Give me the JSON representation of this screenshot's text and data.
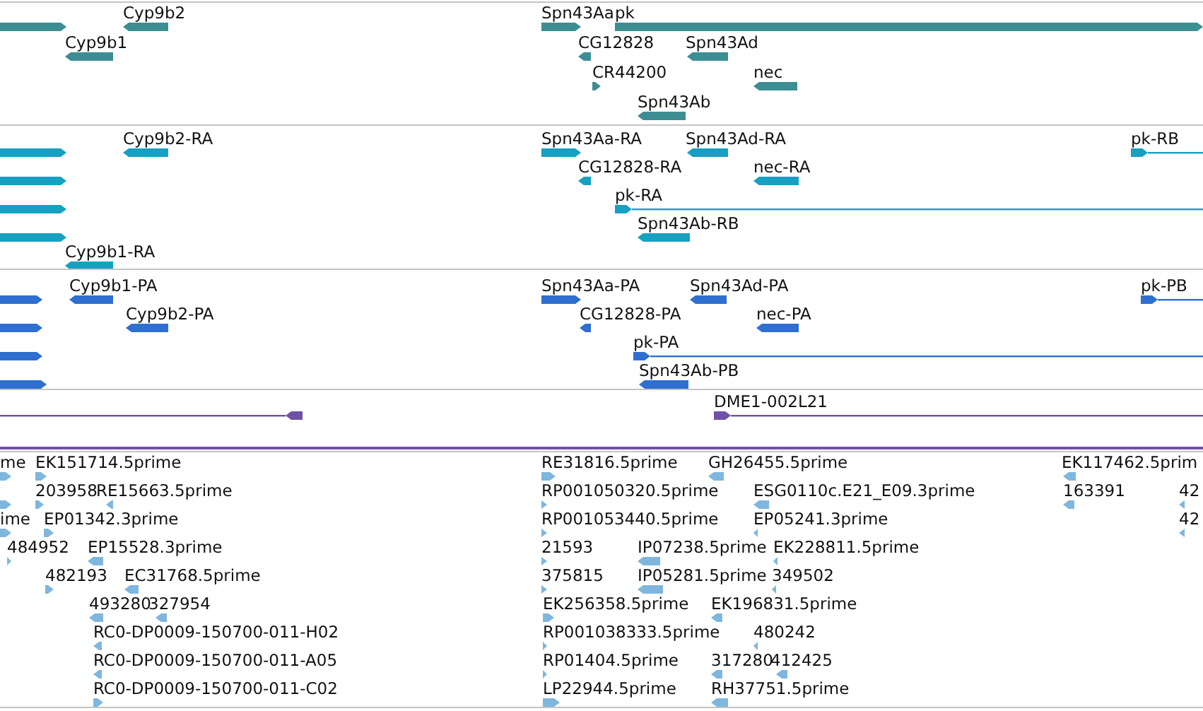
{
  "tracks": [
    {
      "kind": "gene",
      "color": "#3d8e93",
      "features": [
        {
          "kind": "right"
        },
        {
          "label": "Cyp9b2",
          "kind": "left"
        },
        {
          "label": "Cyp9b1",
          "kind": "left"
        },
        {
          "label": "Spn43Aa",
          "kind": "right"
        },
        {
          "label": "pk",
          "kind": "right"
        },
        {
          "label": "CG12828",
          "kind": "left"
        },
        {
          "label": "Spn43Ad",
          "kind": "left"
        },
        {
          "label": "CR44200",
          "kind": "right"
        },
        {
          "label": "nec",
          "kind": "left"
        },
        {
          "label": "Spn43Ab",
          "kind": "left"
        }
      ]
    },
    {
      "kind": "transcript",
      "color": "#17a0c2",
      "features": [
        {
          "kind": "right"
        },
        {
          "kind": "right"
        },
        {
          "kind": "right"
        },
        {
          "kind": "right"
        },
        {
          "label": "Cyp9b2-RA",
          "kind": "left"
        },
        {
          "label": "Cyp9b1-RA",
          "kind": "left"
        },
        {
          "label": "Spn43Aa-RA",
          "kind": "right"
        },
        {
          "label": "Spn43Ad-RA",
          "kind": "left"
        },
        {
          "label": "pk-RB",
          "kind": "rightline"
        },
        {
          "label": "CG12828-RA",
          "kind": "left"
        },
        {
          "label": "nec-RA",
          "kind": "left"
        },
        {
          "label": "pk-RA",
          "kind": "rightline"
        },
        {
          "label": "Spn43Ab-RB",
          "kind": "left"
        }
      ]
    },
    {
      "kind": "protein",
      "color": "#2e6fd0",
      "features": [
        {
          "kind": "right"
        },
        {
          "kind": "right"
        },
        {
          "kind": "right"
        },
        {
          "kind": "right"
        },
        {
          "label": "Cyp9b1-PA",
          "kind": "left"
        },
        {
          "label": "Cyp9b2-PA",
          "kind": "left"
        },
        {
          "label": "Spn43Aa-PA",
          "kind": "right"
        },
        {
          "label": "Spn43Ad-PA",
          "kind": "left"
        },
        {
          "label": "pk-PB",
          "kind": "rightline"
        },
        {
          "label": "CG12828-PA",
          "kind": "left"
        },
        {
          "label": "nec-PA",
          "kind": "left"
        },
        {
          "label": "pk-PA",
          "kind": "rightline"
        },
        {
          "label": "Spn43Ab-PB",
          "kind": "left"
        }
      ]
    },
    {
      "kind": "clone",
      "color": "#6e52a6",
      "features": [
        {
          "kind": "leftline"
        },
        {
          "label": "DME1-002L21",
          "kind": "rightline"
        },
        {
          "kind": "rule"
        }
      ]
    },
    {
      "kind": "est",
      "color": "#7fb6de",
      "features": [
        {
          "label": "me",
          "kind": "right"
        },
        {
          "label": "EK151714.5prime",
          "kind": "right"
        },
        {
          "label": "RE31816.5prime",
          "kind": "right"
        },
        {
          "label": "GH26455.5prime",
          "kind": "left"
        },
        {
          "label": "EK117462.5prim",
          "kind": "left"
        },
        {
          "kind": "right"
        },
        {
          "label": "203958",
          "kind": "right"
        },
        {
          "label": "RE15663.5prime",
          "kind": "left"
        },
        {
          "label": "RP001050320.5prime",
          "kind": "right"
        },
        {
          "label": "ESG0110c.E21_E09.3prime",
          "kind": "left"
        },
        {
          "label": "163391",
          "kind": "left"
        },
        {
          "label": "42",
          "kind": "left"
        },
        {
          "label": "ime",
          "kind": "right"
        },
        {
          "label": "EP01342.3prime",
          "kind": "right"
        },
        {
          "label": "RP001053440.5prime",
          "kind": "right"
        },
        {
          "label": "EP05241.3prime",
          "kind": "left"
        },
        {
          "label": "42",
          "kind": "left"
        },
        {
          "label": "484952",
          "kind": "right"
        },
        {
          "label": "EP15528.3prime",
          "kind": "left"
        },
        {
          "label": "21593",
          "kind": "right"
        },
        {
          "label": "IP07238.5prime",
          "kind": "left"
        },
        {
          "label": "EK228811.5prime",
          "kind": "left"
        },
        {
          "label": "482193",
          "kind": "right"
        },
        {
          "label": "EC31768.5prime",
          "kind": "left"
        },
        {
          "label": "375815",
          "kind": "right"
        },
        {
          "label": "IP05281.5prime",
          "kind": "left"
        },
        {
          "label": "349502",
          "kind": "left"
        },
        {
          "label": "493280",
          "kind": "left"
        },
        {
          "label": "327954",
          "kind": "left"
        },
        {
          "label": "EK256358.5prime",
          "kind": "right"
        },
        {
          "label": "EK196831.5prime",
          "kind": "left"
        },
        {
          "label": "RC0-DP0009-150700-011-H02",
          "kind": "left"
        },
        {
          "label": "RP001038333.5prime",
          "kind": "right"
        },
        {
          "label": "480242",
          "kind": "left"
        },
        {
          "label": "RC0-DP0009-150700-011-A05",
          "kind": "left"
        },
        {
          "label": "RP01404.5prime",
          "kind": "right"
        },
        {
          "label": "317280",
          "kind": "left"
        },
        {
          "label": "412425",
          "kind": "left"
        },
        {
          "label": "RC0-DP0009-150700-011-C02",
          "kind": "right"
        },
        {
          "label": "LP22944.5prime",
          "kind": "right"
        },
        {
          "label": "RH37751.5prime",
          "kind": "left"
        }
      ]
    }
  ]
}
